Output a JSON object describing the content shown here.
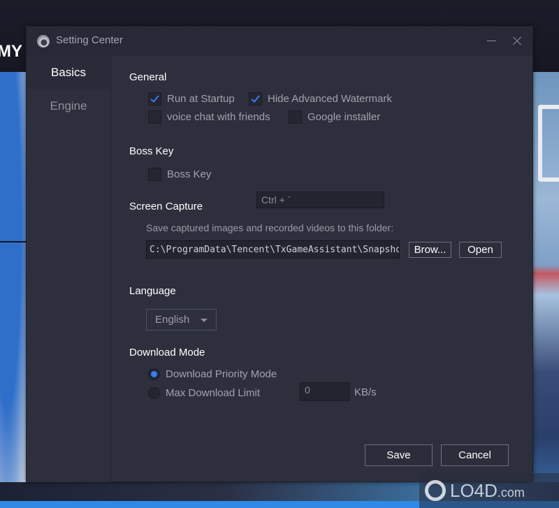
{
  "background": {
    "brand_fragment": "MY",
    "watermark": {
      "text": "LO4D",
      "suffix": ".com"
    }
  },
  "dialog": {
    "title": "Setting Center",
    "controls": {
      "minimize": "minimize",
      "close": "close"
    }
  },
  "sidebar": {
    "items": [
      {
        "label": "Basics",
        "active": true
      },
      {
        "label": "Engine",
        "active": false
      }
    ]
  },
  "general": {
    "title": "General",
    "options": [
      {
        "label": "Run at Startup",
        "checked": true
      },
      {
        "label": "Hide Advanced Watermark",
        "checked": true
      },
      {
        "label": "voice chat with friends",
        "checked": false
      },
      {
        "label": "Google installer",
        "checked": false
      }
    ]
  },
  "boss_key": {
    "title": "Boss Key",
    "checkbox_label": "Boss Key",
    "checked": false,
    "shortcut_value": "Ctrl + `"
  },
  "screen_capture": {
    "title": "Screen Capture",
    "hint": "Save captured images and recorded videos to this folder:",
    "path": "C:\\ProgramData\\Tencent\\TxGameAssistant\\Snapshot",
    "browse_label": "Brow...",
    "open_label": "Open"
  },
  "language": {
    "title": "Language",
    "selected": "English"
  },
  "download_mode": {
    "title": "Download Mode",
    "options": [
      {
        "label": "Download Priority Mode",
        "selected": true
      },
      {
        "label": "Max Download Limit",
        "selected": false
      }
    ],
    "limit_value": "0",
    "unit": "KB/s"
  },
  "footer": {
    "save_label": "Save",
    "cancel_label": "Cancel"
  },
  "colors": {
    "accent": "#3b7bf0",
    "dialog_bg": "#2d2f3d",
    "titlebar_bg": "#272937"
  }
}
